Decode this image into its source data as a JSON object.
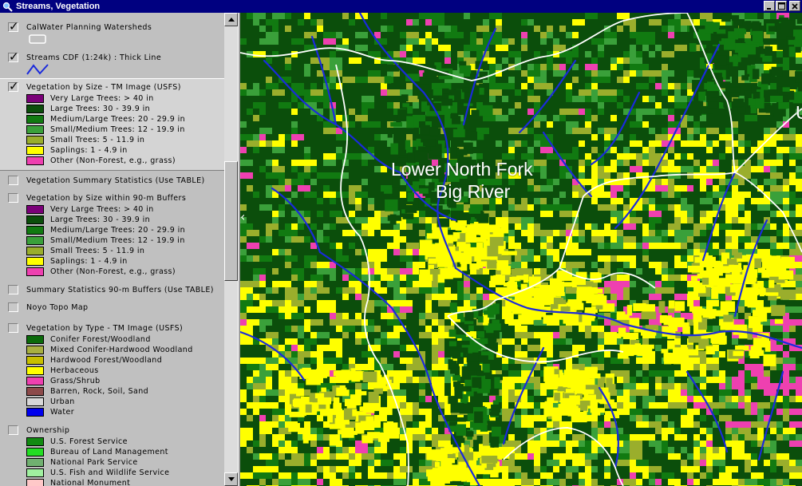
{
  "window": {
    "title": "Streams, Vegetation"
  },
  "colors": {
    "very_large": "#7a0078",
    "large": "#0b4e0b",
    "medium_large": "#117a11",
    "small_medium": "#3aa03a",
    "small": "#9aae2c",
    "saplings": "#ffff00",
    "other": "#ee40b0",
    "conifer": "#0a6a0a",
    "mixed": "#a8b040",
    "hardwood": "#c8c000",
    "herbaceous": "#ffff00",
    "grass": "#ee40b0",
    "barren": "#8c4a4a",
    "urban": "#d8d8d8",
    "water": "#0000ee",
    "usfs": "#118a11",
    "blm": "#22dd22",
    "nps": "#70b070",
    "usfws": "#a0f0a0",
    "natmon": "#ffc8c8",
    "stream": "#1a2adc",
    "boundary": "#ffffff"
  },
  "legend": {
    "themes": [
      {
        "label": "CalWater Planning Watersheds",
        "checked": true,
        "symbol": "polygon-outline-icon"
      },
      {
        "label": "Streams CDF (1:24k) : Thick Line",
        "checked": true,
        "symbol": "line-icon"
      },
      {
        "label": "Vegetation by Size - TM Image (USFS)",
        "checked": true,
        "items": [
          {
            "label": "Very Large Trees: > 40  in",
            "color": "#7a0078"
          },
          {
            "label": "Large Trees: 30 - 39.9 in",
            "color": "#0b4e0b"
          },
          {
            "label": "Medium/Large Trees: 20 - 29.9 in",
            "color": "#117a11"
          },
          {
            "label": "Small/Medium Trees: 12 - 19.9 in",
            "color": "#3aa03a"
          },
          {
            "label": "Small Trees: 5 - 11.9 in",
            "color": "#9aae2c"
          },
          {
            "label": "Saplings: 1 - 4.9 in",
            "color": "#ffff00"
          },
          {
            "label": "Other (Non-Forest, e.g., grass)",
            "color": "#ee40b0"
          }
        ]
      },
      {
        "label": "Vegetation Summary Statistics (Use TABLE)",
        "checked": false
      },
      {
        "label": "Vegetation by Size within 90-m Buffers",
        "checked": false,
        "items": [
          {
            "label": "Very Large Trees: > 40  in",
            "color": "#7a0078"
          },
          {
            "label": "Large Trees: 30 - 39.9 in",
            "color": "#0b4e0b"
          },
          {
            "label": "Medium/Large Trees: 20 - 29.9 in",
            "color": "#117a11"
          },
          {
            "label": "Small/Medium Trees: 12 - 19.9 in",
            "color": "#3aa03a"
          },
          {
            "label": "Small Trees: 5 - 11.9 in",
            "color": "#9aae2c"
          },
          {
            "label": "Saplings: 1 - 4.9 in",
            "color": "#ffff00"
          },
          {
            "label": "Other (Non-Forest, e.g., grass)",
            "color": "#ee40b0"
          }
        ]
      },
      {
        "label": "Summary Statistics 90-m Buffers (Use TABLE)",
        "checked": false
      },
      {
        "label": "Noyo Topo Map",
        "checked": false
      },
      {
        "label": "Vegetation by Type - TM Image (USFS)",
        "checked": false,
        "items": [
          {
            "label": "Conifer Forest/Woodland",
            "color": "#0a6a0a"
          },
          {
            "label": "Mixed Conifer-Hardwood Woodland",
            "color": "#a8b040"
          },
          {
            "label": "Hardwood Forest/Woodland",
            "color": "#c8c000"
          },
          {
            "label": "Herbaceous",
            "color": "#ffff00"
          },
          {
            "label": "Grass/Shrub",
            "color": "#ee40b0"
          },
          {
            "label": "Barren, Rock, Soil, Sand",
            "color": "#8c4a4a"
          },
          {
            "label": "Urban",
            "color": "#d8d8d8"
          },
          {
            "label": "Water",
            "color": "#0000ee"
          }
        ]
      },
      {
        "label": "Ownership",
        "checked": false,
        "items": [
          {
            "label": "U.S. Forest Service",
            "color": "#118a11"
          },
          {
            "label": "Bureau of Land Management",
            "color": "#22dd22"
          },
          {
            "label": "National Park Service",
            "color": "#70b070"
          },
          {
            "label": "U.S. Fish and Wildlife Service",
            "color": "#a0f0a0"
          },
          {
            "label": "National Monument",
            "color": "#ffc8c8"
          }
        ]
      }
    ]
  },
  "map": {
    "label_line1": "Lower North Fork",
    "label_line2": "Big River",
    "edge_label": "U"
  }
}
